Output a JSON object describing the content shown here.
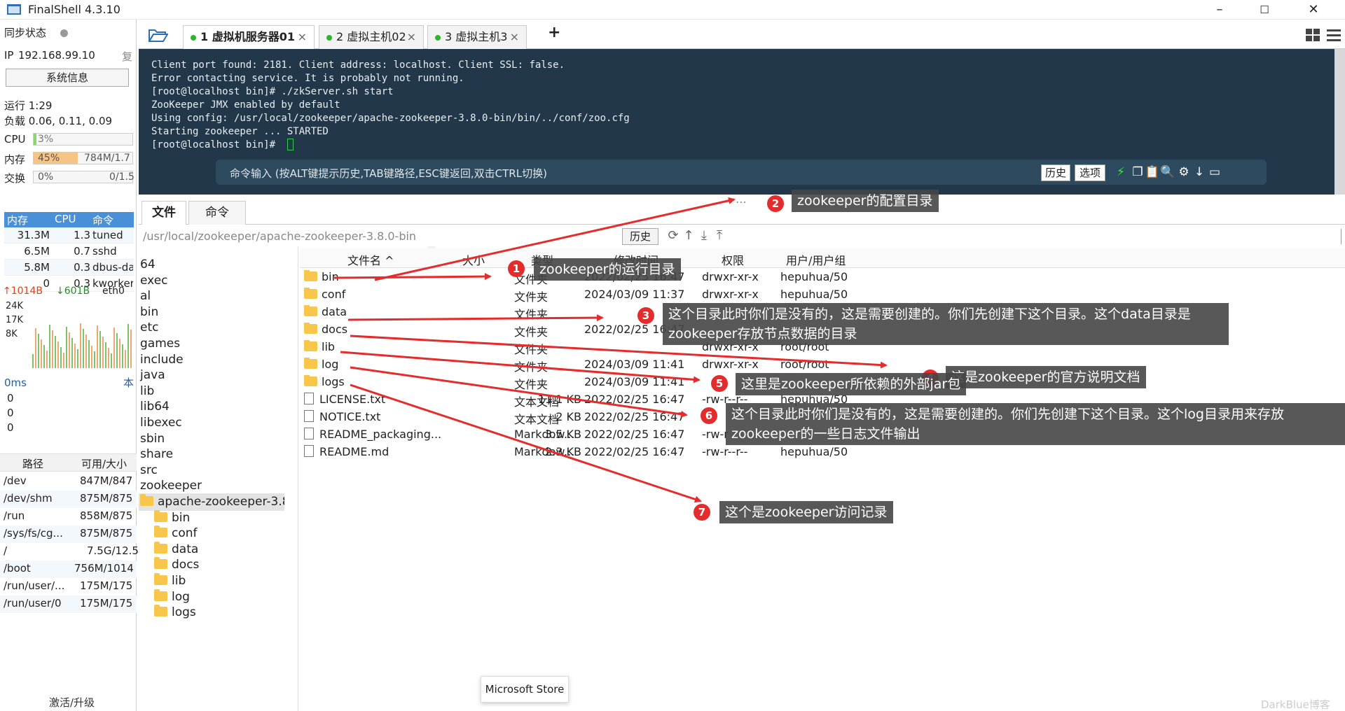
{
  "window": {
    "title": "FinalShell 4.3.10",
    "minimize": "–",
    "maximize": "☐",
    "close": "✕"
  },
  "sidebar": {
    "sync_label": "同步状态",
    "ip_label": "IP",
    "ip_value": "192.168.99.10",
    "copy_label": "复",
    "sysinfo_button": "系统信息",
    "uptime": "运行 1:29",
    "load": "负载 0.06, 0.11, 0.09",
    "cpu": {
      "label": "CPU",
      "value": "3%",
      "percent": 3
    },
    "mem": {
      "label": "内存",
      "value": "45%",
      "detail": "784M/1.7",
      "percent": 45
    },
    "swap": {
      "label": "交换",
      "value": "0%",
      "detail": "0/1.5",
      "percent": 0
    },
    "proc_headers": [
      "内存",
      "CPU",
      "命令"
    ],
    "processes": [
      {
        "mem": "31.3M",
        "cpu": "1.3",
        "cmd": "tuned"
      },
      {
        "mem": "6.5M",
        "cpu": "0.7",
        "cmd": "sshd"
      },
      {
        "mem": "5.8M",
        "cpu": "0.3",
        "cmd": "dbus-da"
      },
      {
        "mem": "0",
        "cpu": "0.3",
        "cmd": "kworker"
      }
    ],
    "net": {
      "up": "↑1014B",
      "down": "↓601B",
      "iface": "eth0",
      "ticks": [
        "24K",
        "17K",
        "8K"
      ]
    },
    "ping": {
      "label": "0ms",
      "right": "本",
      "values": [
        "0",
        "0",
        "0"
      ]
    },
    "disk_headers": [
      "路径",
      "可用/大小"
    ],
    "disks": [
      {
        "path": "/dev",
        "size": "847M/847"
      },
      {
        "path": "/dev/shm",
        "size": "875M/875"
      },
      {
        "path": "/run",
        "size": "858M/875"
      },
      {
        "path": "/sys/fs/cg...",
        "size": "875M/875"
      },
      {
        "path": "/",
        "size": "7.5G/12.5"
      },
      {
        "path": "/boot",
        "size": "756M/1014"
      },
      {
        "path": "/run/user/...",
        "size": "175M/175"
      },
      {
        "path": "/run/user/0",
        "size": "175M/175"
      }
    ],
    "activate": "激活/升级"
  },
  "tabs": [
    {
      "label": "1 虚拟机服务器01",
      "close": "×"
    },
    {
      "label": "2 虚拟主机02",
      "close": "×"
    },
    {
      "label": "3 虚拟主机3",
      "close": "×"
    }
  ],
  "add_tab": "+",
  "terminal": {
    "text": "Client port found: 2181. Client address: localhost. Client SSL: false.\nError contacting service. It is probably not running.\n[root@localhost bin]# ./zkServer.sh start\nZooKeeper JMX enabled by default\nUsing config: /usr/local/zookeeper/apache-zookeeper-3.8.0-bin/bin/../conf/zoo.cfg\nStarting zookeeper ... STARTED\n[root@localhost bin]# ",
    "cmd_hint": "命令输入 (按ALT键提示历史,TAB键路径,ESC键返回,双击CTRL切换)",
    "history_btn": "历史",
    "options_btn": "选项"
  },
  "filemgr": {
    "tab_files": "文件",
    "tab_commands": "命令",
    "path": "/usr/local/zookeeper/apache-zookeeper-3.8.0-bin",
    "history_btn": "历史",
    "tree_items": [
      "64",
      "exec",
      "al",
      "bin",
      "etc",
      "games",
      "include",
      "java",
      "lib",
      "lib64",
      "libexec",
      "sbin",
      "share",
      "src",
      "zookeeper"
    ],
    "tree_selected": "apache-zookeeper-3.8.0-",
    "tree_children": [
      "bin",
      "conf",
      "data",
      "docs",
      "lib",
      "log",
      "logs"
    ],
    "columns": [
      "文件名 ^",
      "大小",
      "类型",
      "修改时间",
      "权限",
      "用户/用户组"
    ],
    "files": [
      {
        "name": "bin",
        "size": "",
        "type": "文件夹",
        "mtime": "2022/02/25 16:47",
        "perm": "drwxr-xr-x",
        "owner": "hepuhua/50",
        "folder": true
      },
      {
        "name": "conf",
        "size": "",
        "type": "文件夹",
        "mtime": "2024/03/09 11:37",
        "perm": "drwxr-xr-x",
        "owner": "hepuhua/50",
        "folder": true
      },
      {
        "name": "data",
        "size": "",
        "type": "文件夹",
        "mtime": "",
        "perm": "",
        "owner": "",
        "folder": true
      },
      {
        "name": "docs",
        "size": "",
        "type": "文件夹",
        "mtime": "2022/02/25 16:47",
        "perm": "",
        "owner": "",
        "folder": true
      },
      {
        "name": "lib",
        "size": "",
        "type": "文件夹",
        "mtime": "",
        "perm": "drwxr-xr-x",
        "owner": "root/root",
        "folder": true
      },
      {
        "name": "log",
        "size": "",
        "type": "文件夹",
        "mtime": "2024/03/09 11:41",
        "perm": "drwxr-xr-x",
        "owner": "root/root",
        "folder": true
      },
      {
        "name": "logs",
        "size": "",
        "type": "文件夹",
        "mtime": "2024/03/09 11:41",
        "perm": "",
        "owner": "",
        "folder": true
      },
      {
        "name": "LICENSE.txt",
        "size": "11.1 KB",
        "type": "文本文档",
        "mtime": "2022/02/25 16:47",
        "perm": "-rw-r--r--",
        "owner": "hepuhua/50",
        "folder": false
      },
      {
        "name": "NOTICE.txt",
        "size": "2 KB",
        "type": "文本文档",
        "mtime": "2022/02/25 16:47",
        "perm": "",
        "owner": "",
        "folder": false
      },
      {
        "name": "README_packaging...",
        "size": "3.5 KB",
        "type": "Markdow...",
        "mtime": "2022/02/25 16:47",
        "perm": "-rw-r",
        "owner": "",
        "folder": false
      },
      {
        "name": "README.md",
        "size": "2.3 KB",
        "type": "Markdow...",
        "mtime": "2022/02/25 16:47",
        "perm": "-rw-r--r--",
        "owner": "hepuhua/50",
        "folder": false
      }
    ]
  },
  "annotations": [
    {
      "num": "1",
      "text": "zookeeper的运行目录"
    },
    {
      "num": "2",
      "text": "zookeeper的配置目录"
    },
    {
      "num": "3",
      "text": "这个目录此时你们是没有的，这是需要创建的。你们先创建下这个目录。这个data目录是 zookeeper存放节点数据的目录"
    },
    {
      "num": "4",
      "text": "这是zookeeper的官方说明文档"
    },
    {
      "num": "5",
      "text": "这里是zookeeper所依赖的外部jar包"
    },
    {
      "num": "6",
      "text": "这个目录此时你们是没有的，这是需要创建的。你们先创建下这个目录。这个log目录用来存放 zookeeper的一些日志文件输出"
    },
    {
      "num": "7",
      "text": "这个是zookeeper访问记录"
    }
  ],
  "toast": "Microsoft Store",
  "watermark": "DarkBlue博客",
  "colors": {
    "terminal_bg": "#22384a",
    "accent": "#4a90d9",
    "annotation_red": "#e52b2b",
    "cpu_bar": "#8bd66f",
    "mem_bar": "#f6c485"
  }
}
